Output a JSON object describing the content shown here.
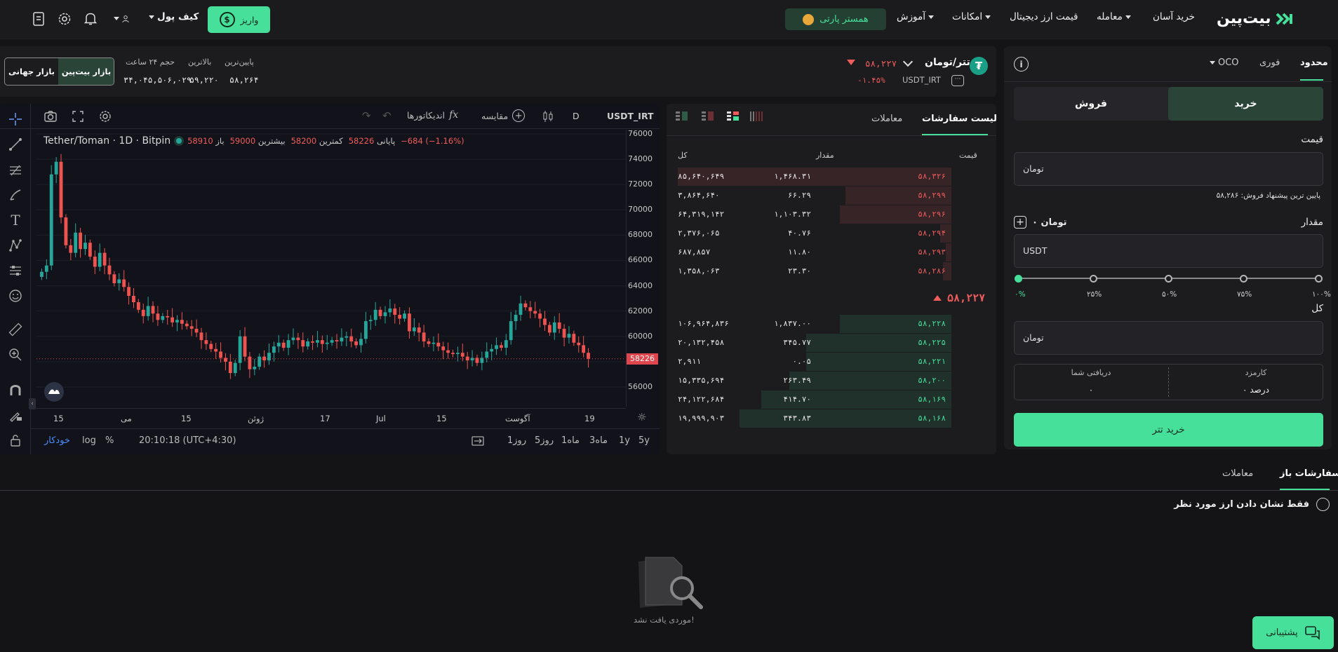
{
  "header": {
    "logo_text": "بیت‌پین",
    "nav": [
      "خرید آسان",
      "معامله",
      "قیمت ارز دیجیتال",
      "امکانات",
      "آموزش"
    ],
    "hamster_label": "همستر پارتی",
    "deposit_label": "واریز",
    "wallet_label": "کیف پول"
  },
  "order_form": {
    "tabs": [
      "محدود",
      "فوری",
      "OCO"
    ],
    "buy_label": "خرید",
    "sell_label": "فروش",
    "price_label": "قیمت",
    "price_placeholder": "تومان",
    "lowest_offer": "پایین ترین پیشنهاد فروش: ۵۸,۲۸۶",
    "amount_label": "مقدار",
    "amount_balance": "۰ تومان",
    "amount_placeholder": "USDT",
    "slider": [
      "۱۰۰%",
      "۷۵%",
      "۵۰%",
      "۲۵%",
      "۰%"
    ],
    "total_label": "کل",
    "total_placeholder": "تومان",
    "fee_label": "کارمزد",
    "fee_value": "۰ درصد",
    "receive_label": "دریافتی شما",
    "receive_value": "۰",
    "submit_label": "خرید تتر"
  },
  "market": {
    "pair": "تتر/تومان",
    "symbol": "USDT_IRT",
    "price": "۵۸,۲۲۷",
    "change": "-۱.۴۵%",
    "low_label": "پایین‌ترین",
    "low_value": "۵۸,۲۶۴",
    "high_label": "بالاترین",
    "high_value": "۵۹,۲۲۰",
    "vol_label": "حجم ۲۴ ساعت",
    "vol_value": "۳۴,۰۴۵,۵۰۶,۰۲۹",
    "market_bitpin": "بازار بیت‌پین",
    "market_global": "بازار جهانی"
  },
  "orderbook": {
    "tab_book": "لیست سفارشات",
    "tab_trades": "معاملات",
    "col_price": "قیمت",
    "col_amount": "مقدار",
    "col_total": "کل",
    "asks": [
      {
        "price": "۵۸,۳۲۶",
        "amount": "۱,۴۶۸.۳۱",
        "total": "۸۵,۶۴۰,۶۴۹",
        "depth": 0.98
      },
      {
        "price": "۵۸,۲۹۹",
        "amount": "۶۶.۲۹",
        "total": "۳,۸۶۴,۶۴۰",
        "depth": 0.38
      },
      {
        "price": "۵۸,۲۹۶",
        "amount": "۱,۱۰۳.۳۲",
        "total": "۶۴,۳۱۹,۱۴۲",
        "depth": 0.4
      },
      {
        "price": "۵۸,۲۹۴",
        "amount": "۴۰.۷۶",
        "total": "۲,۳۷۶,۰۶۵",
        "depth": 0.04
      },
      {
        "price": "۵۸,۲۹۳",
        "amount": "۱۱.۸۰",
        "total": "۶۸۷,۸۵۷",
        "depth": 0.02
      },
      {
        "price": "۵۸,۲۸۶",
        "amount": "۲۳.۳۰",
        "total": "۱,۳۵۸,۰۶۳",
        "depth": 0.03
      }
    ],
    "mid_price": "۵۸,۲۲۷",
    "bids": [
      {
        "price": "۵۸,۲۲۸",
        "amount": "۱,۸۳۷.۰۰",
        "total": "۱۰۶,۹۶۴,۸۳۶",
        "depth": 0.4
      },
      {
        "price": "۵۸,۲۲۵",
        "amount": "۳۴۵.۷۷",
        "total": "۲۰,۱۳۲,۴۵۸",
        "depth": 0.52
      },
      {
        "price": "۵۸,۲۲۱",
        "amount": "۰.۰۵",
        "total": "۲,۹۱۱",
        "depth": 0.52
      },
      {
        "price": "۵۸,۲۰۰",
        "amount": "۲۶۳.۴۹",
        "total": "۱۵,۳۳۵,۶۹۴",
        "depth": 0.58
      },
      {
        "price": "۵۸,۱۶۹",
        "amount": "۴۱۴.۷۰",
        "total": "۲۴,۱۲۲,۶۸۴",
        "depth": 0.68
      },
      {
        "price": "۵۸,۱۶۸",
        "amount": "۳۴۳.۸۳",
        "total": "۱۹,۹۹۹,۹۰۳",
        "depth": 0.76
      }
    ]
  },
  "chart_toolbar": {
    "symbol": "USDT_IRT",
    "interval": "D",
    "compare": "مقایسه",
    "indicators": "اندیکاتورها"
  },
  "chart_legend": {
    "name": "Tether/Toman · 1D · Bitpin",
    "open_label": "باز",
    "open_value": "58910",
    "high_label": "بیشترین",
    "high_value": "59000",
    "low_label": "کمترین",
    "low_value": "58200",
    "close_label": "پایانی",
    "close_value": "58226",
    "change": "−684 (−1.16%)"
  },
  "chart_bottom": {
    "timeframes": [
      "5y",
      "1y",
      "3ماه",
      "1ماه",
      "5روز",
      "1روز"
    ],
    "time": "20:10:18 (UTC+4:30)",
    "pct": "%",
    "log": "log",
    "auto": "خودکار"
  },
  "chart_data": {
    "type": "candlestick",
    "title": "Tether/Toman · 1D · Bitpin",
    "ylim": [
      55000,
      76000
    ],
    "yticks": [
      76000,
      74000,
      72000,
      70000,
      68000,
      66000,
      64000,
      62000,
      60000,
      58000,
      56000
    ],
    "xticks": [
      "15",
      "می",
      "15",
      "ژوئن",
      "17",
      "Jul",
      "15",
      "آگوست",
      "19"
    ],
    "last_price": "58226",
    "closes": [
      65100,
      65600,
      72800,
      73800,
      69400,
      67200,
      66600,
      68200,
      66900,
      67400,
      66300,
      65500,
      66600,
      65600,
      64900,
      64200,
      64500,
      63900,
      63200,
      62700,
      62100,
      61600,
      62400,
      61800,
      61300,
      61600,
      61500,
      61100,
      61300,
      61000,
      60800,
      60600,
      60300,
      59700,
      59400,
      59000,
      58800,
      58300,
      58000,
      57100,
      57900,
      60000,
      58400,
      57400,
      57600,
      58400,
      58100,
      58700,
      59200,
      59500,
      59100,
      59700,
      59900,
      59700,
      59200,
      59600,
      59500,
      59700,
      59400,
      59500,
      59700,
      59600,
      59900,
      60000,
      59600,
      59300,
      59800,
      61200,
      61300,
      62100,
      61600,
      61900,
      62200,
      61700,
      61400,
      61800,
      60400,
      60700,
      60300,
      59600,
      59400,
      59500,
      59200,
      58900,
      58700,
      58600,
      58700,
      58400,
      58100,
      58300,
      57900,
      58300,
      58800,
      59000,
      59300,
      59100,
      59700,
      61200,
      61700,
      62600,
      62300,
      62000,
      61800,
      61400,
      60900,
      60300,
      61100,
      60600,
      59900,
      60200,
      59500,
      59300,
      58700,
      58226
    ]
  },
  "bottom": {
    "tab_open": "سفارشات باز",
    "tab_trades": "معاملات",
    "filter_label": "فقط نشان دادن ارز مورد نظر",
    "empty": "موردی یافت نشد!",
    "support": "پشتیبانی"
  }
}
